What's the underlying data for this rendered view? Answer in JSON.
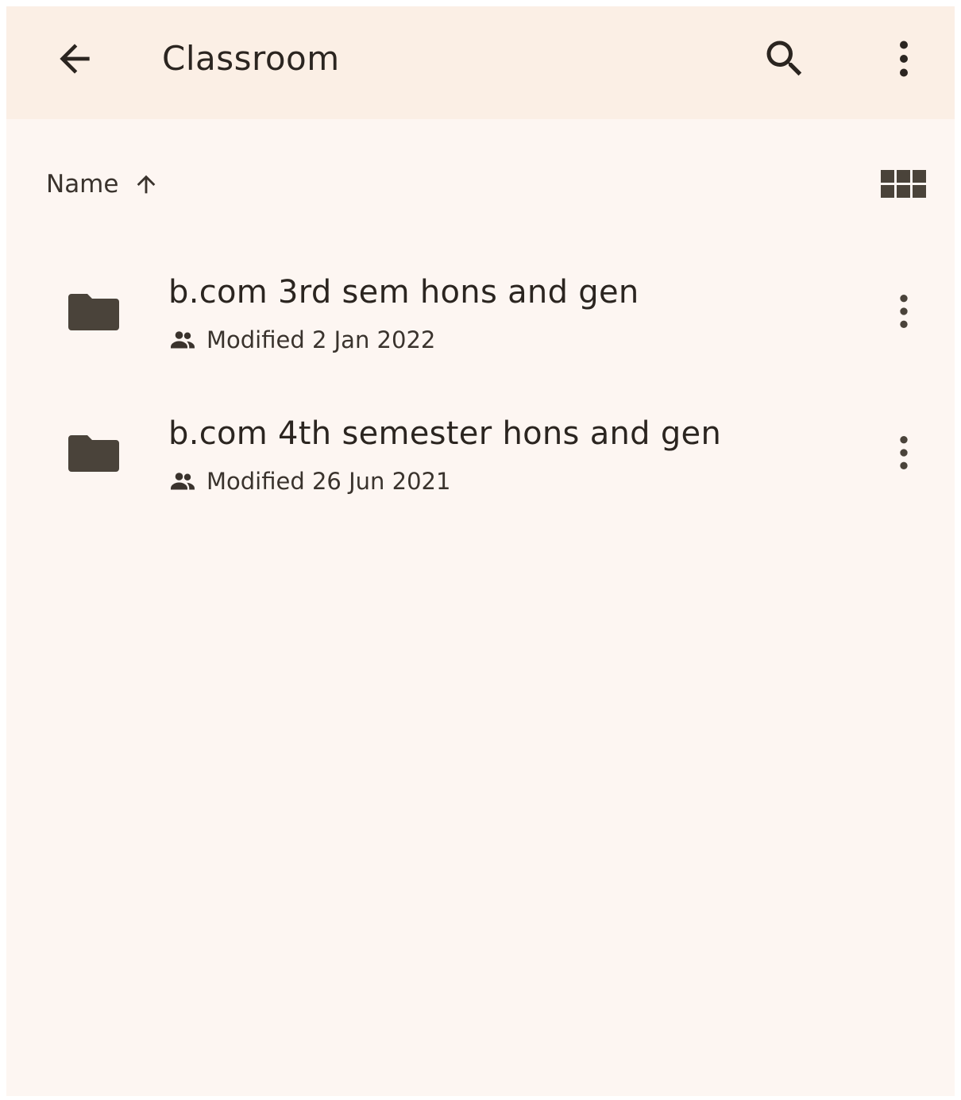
{
  "app_bar": {
    "title": "Classroom",
    "back_icon": "arrow-back-icon",
    "search_icon": "search-icon",
    "more_icon": "more-vert-icon"
  },
  "sort": {
    "label": "Name",
    "direction_icon": "arrow-up-icon",
    "view_toggle_icon": "grid-view-icon"
  },
  "files": [
    {
      "name": "b.com 3rd sem hons and gen",
      "modified": "Modified 2 Jan 2022",
      "type_icon": "folder-icon",
      "shared_icon": "people-icon"
    },
    {
      "name": "b.com 4th semester hons and gen",
      "modified": "Modified 26 Jun 2021",
      "type_icon": "folder-icon",
      "shared_icon": "people-icon"
    }
  ],
  "colors": {
    "app_bar_bg": "#fbefe5",
    "page_bg": "#fdf6f2",
    "icon": "#4a433a",
    "text": "#2b2520"
  }
}
